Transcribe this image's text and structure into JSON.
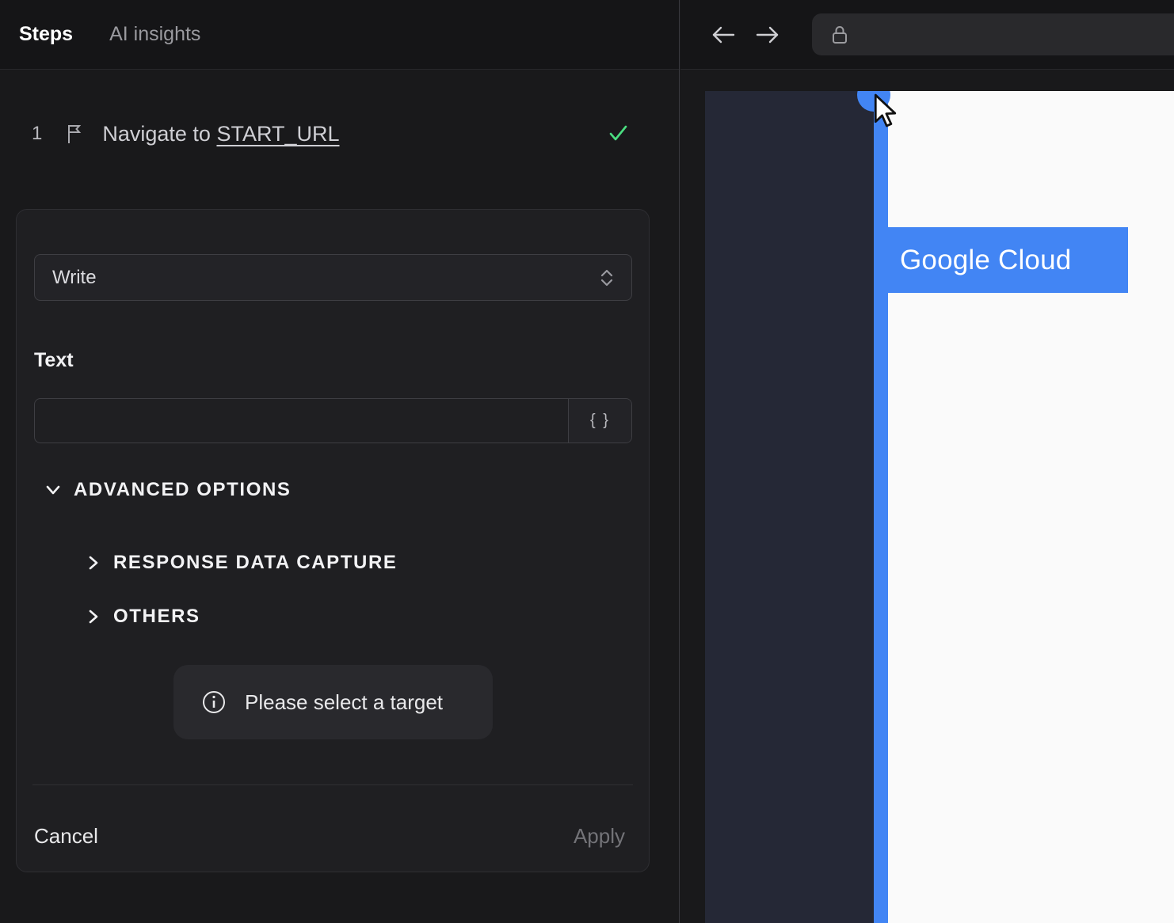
{
  "colors": {
    "accent": "#4285f4",
    "success": "#4ade80"
  },
  "left_panel": {
    "tabs": [
      {
        "label": "Steps"
      },
      {
        "label": "AI insights"
      }
    ],
    "step": {
      "number": "1",
      "text_prefix": "Navigate to ",
      "link": "START_URL"
    },
    "editor": {
      "action_select": {
        "value": "Write"
      },
      "text_field": {
        "label": "Text",
        "value": "",
        "token_button": "{ }"
      },
      "advanced_options_label": "ADVANCED OPTIONS",
      "sections": [
        {
          "label": "RESPONSE DATA CAPTURE"
        },
        {
          "label": "OTHERS"
        }
      ],
      "target_hint": "Please select a target",
      "footer": {
        "cancel_label": "Cancel",
        "apply_label": "Apply"
      }
    }
  },
  "browser": {
    "page": {
      "highlight_label": "Google Cloud"
    }
  }
}
